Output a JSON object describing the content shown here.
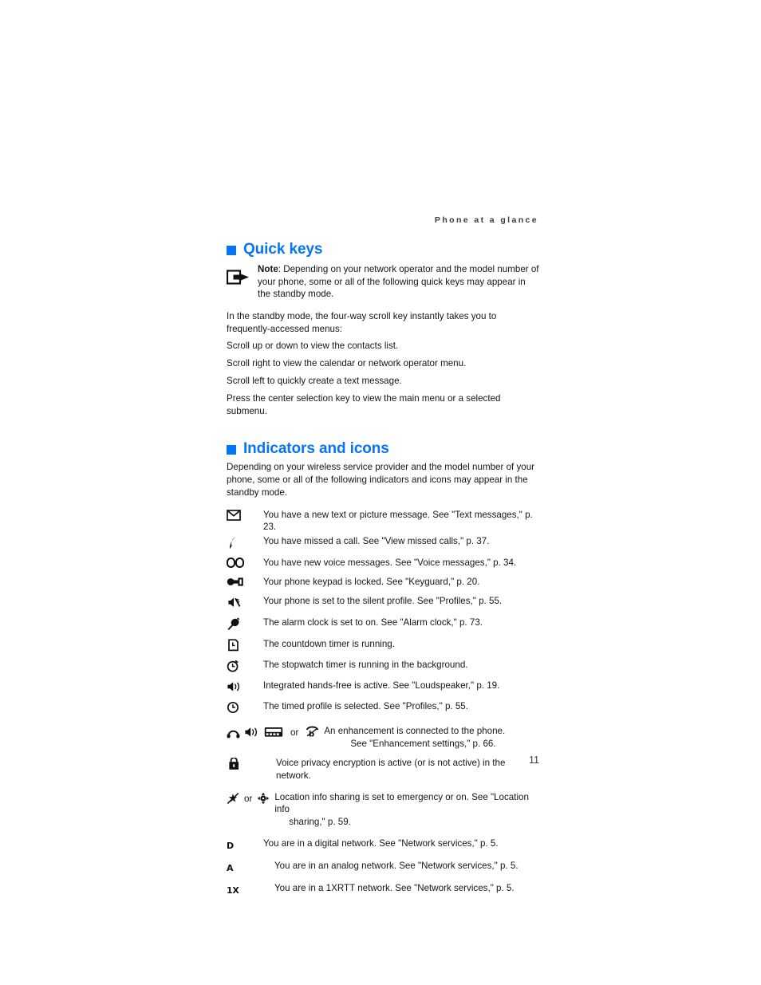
{
  "document": {
    "running_header": "Phone at a glance",
    "page_number": "11"
  },
  "quick_keys": {
    "heading": "Quick keys",
    "note_label": "Note",
    "note_text": ": Depending on your network operator and the model number of your phone, some or all of the following quick keys may appear in the standby mode.",
    "paragraphs": [
      "In the standby mode, the four-way scroll key instantly takes you to frequently-accessed menus:",
      "Scroll up or down to view the contacts list.",
      "Scroll right to view the calendar or network operator menu.",
      "Scroll left to quickly create a text message.",
      "Press the center selection key to view the main menu or a selected submenu."
    ]
  },
  "indicators": {
    "heading": "Indicators and icons",
    "intro": "Depending on your wireless service provider and the model number of your phone, some or all of the following indicators and icons may appear in the standby mode.",
    "rows": [
      {
        "icon": "envelope-icon",
        "text": "You have a new text or picture message. See \"Text messages,\" p. 23."
      },
      {
        "icon": "missed-call-icon",
        "text": "You have missed a call. See \"View missed calls,\" p. 37."
      },
      {
        "icon": "voice-mail-icon",
        "text": "You have new voice messages. See \"Voice messages,\" p. 34."
      },
      {
        "icon": "keyguard-key-icon",
        "text": "Your phone keypad is locked. See \"Keyguard,\" p. 20."
      },
      {
        "icon": "silent-profile-icon",
        "text": "Your phone is set to the silent profile. See \"Profiles,\" p. 55."
      },
      {
        "icon": "alarm-clock-icon",
        "text": "The alarm clock is set to on. See \"Alarm clock,\" p. 73."
      },
      {
        "icon": "countdown-timer-icon",
        "text": "The countdown timer is running."
      },
      {
        "icon": "stopwatch-icon",
        "text": "The stopwatch timer is running in the background."
      },
      {
        "icon": "loudspeaker-icon",
        "text": "Integrated hands-free is active. See \"Loudspeaker,\" p. 19."
      },
      {
        "icon": "timed-profile-icon",
        "text": "The timed profile is selected. See \"Profiles,\" p. 55."
      }
    ],
    "enhancement": {
      "or_label": "or",
      "line1": "An enhancement is connected to the phone.",
      "line2": "See \"Enhancement settings,\" p. 66."
    },
    "privacy": {
      "text": "Voice privacy encryption is active (or is not active) in the network."
    },
    "location": {
      "or_label": "or",
      "line1": "Location info sharing is set to emergency or on. See \"Location info",
      "line2": "sharing,\" p. 59."
    },
    "network_rows": [
      {
        "glyph": "D",
        "icon": "digital-network-icon",
        "text": "You are in a digital network. See \"Network services,\" p. 5."
      },
      {
        "glyph": "A",
        "icon": "analog-network-icon",
        "text": "You are in an analog network. See \"Network services,\" p. 5."
      },
      {
        "glyph": "1X",
        "icon": "1xrtt-network-icon",
        "text": "You are in a 1XRTT network. See \"Network services,\" p. 5."
      }
    ]
  },
  "colors": {
    "heading_blue": "#0675f5",
    "body_text": "#161616"
  }
}
